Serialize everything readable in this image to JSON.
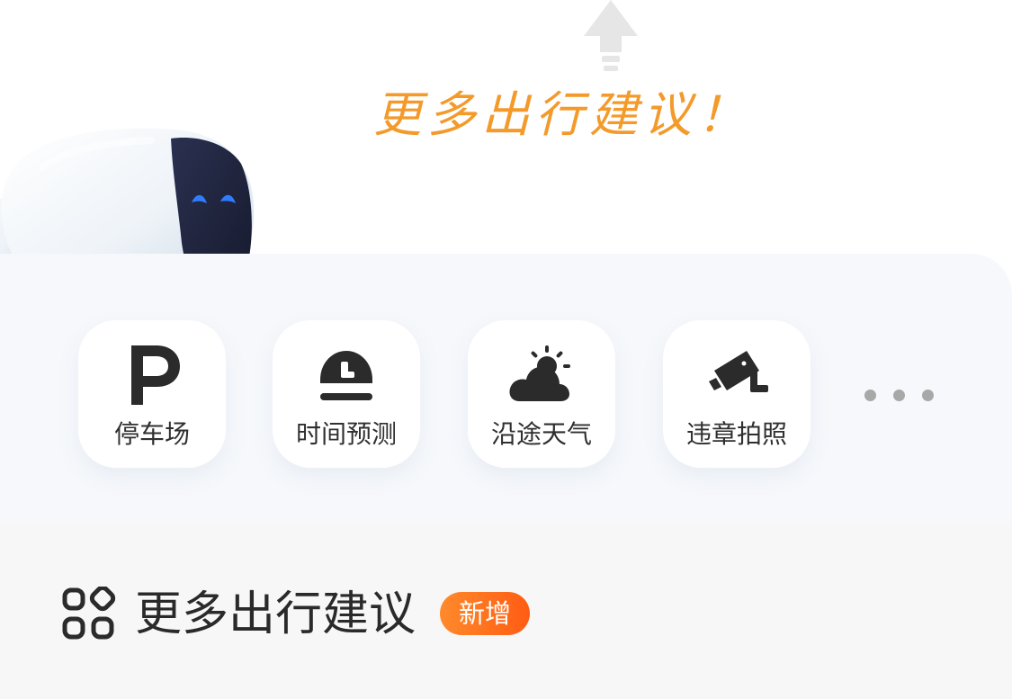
{
  "hint": {
    "text": "更多出行建议！"
  },
  "services": [
    {
      "label": "停车场",
      "icon": "parking-icon"
    },
    {
      "label": "时间预测",
      "icon": "clock-icon"
    },
    {
      "label": "沿途天气",
      "icon": "weather-icon"
    },
    {
      "label": "违章拍照",
      "icon": "traffic-camera-icon"
    }
  ],
  "more": {
    "icon": "more-dots-icon"
  },
  "footer": {
    "title": "更多出行建议",
    "badge": "新增",
    "icon": "grid-apps-icon"
  },
  "colors": {
    "accent": "#f39a2b",
    "badge_start": "#ff8a2b",
    "badge_end": "#ff5c13",
    "panel": "#f6f8fb",
    "footer_bg": "#f7f7f7",
    "text": "#2f2f2f",
    "robot_eye": "#2f7dff"
  }
}
